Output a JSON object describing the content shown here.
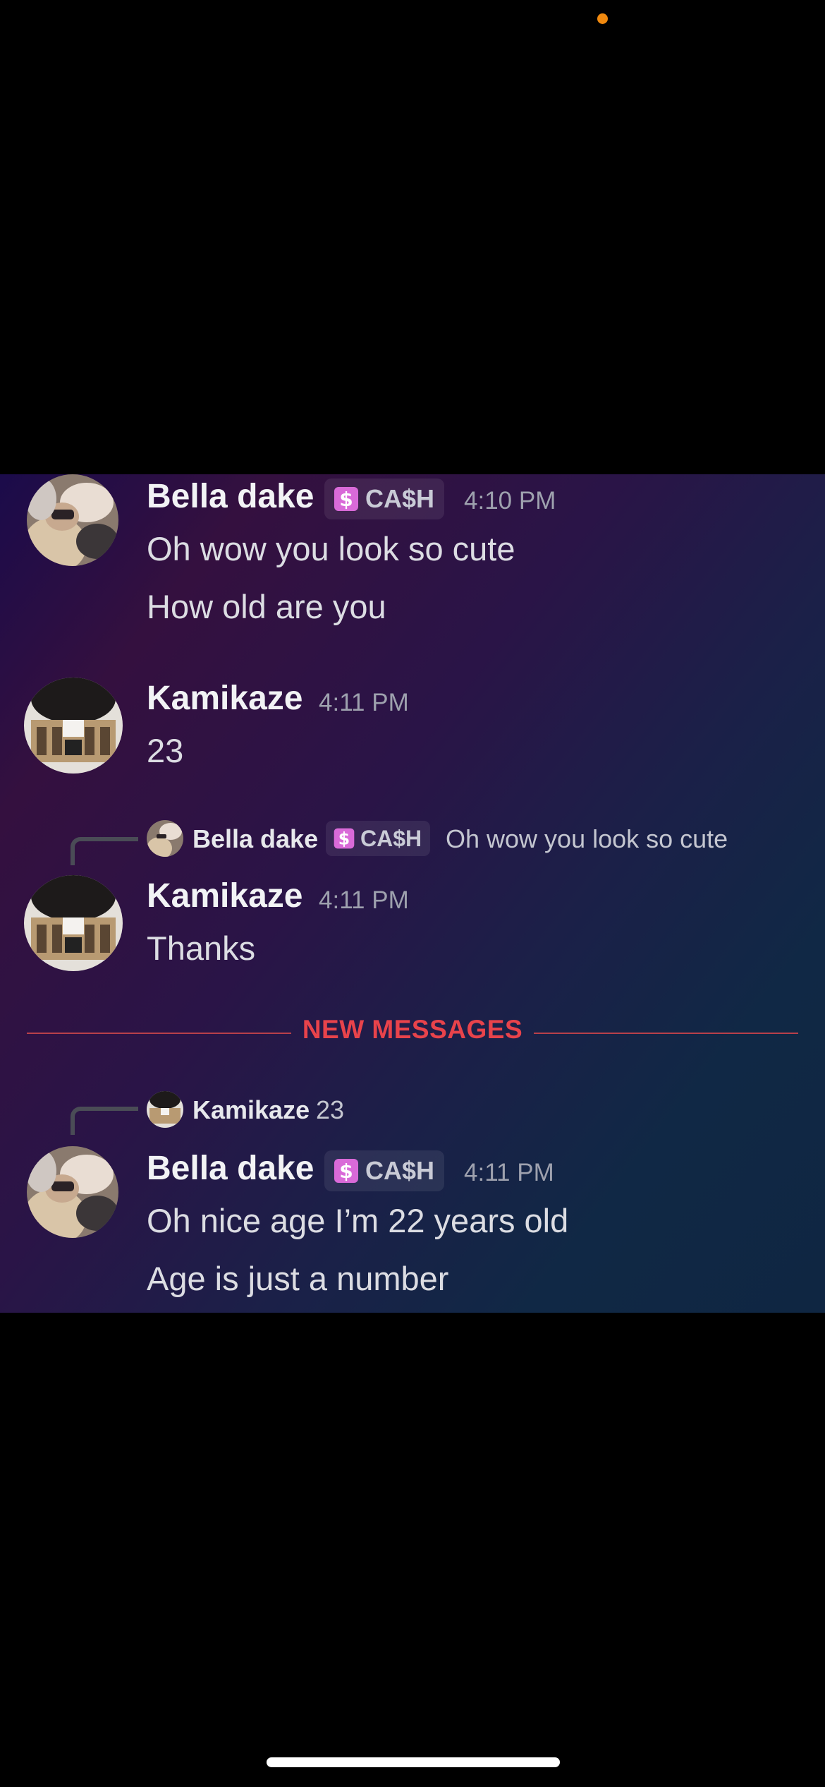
{
  "role_tag": {
    "label": "CA$H",
    "icon": "cash-role-icon",
    "color": "#d96ad8"
  },
  "messages": [
    {
      "author": "Bella dake",
      "tag": "CA$H",
      "time": "4:10 PM",
      "lines": [
        "Oh wow you look so cute",
        "How old are you"
      ]
    },
    {
      "author": "Kamikaze",
      "time": "4:11 PM",
      "lines": [
        "23"
      ]
    },
    {
      "reply_to": {
        "author": "Bella dake",
        "tag": "CA$H",
        "text": "Oh wow you look so cute"
      },
      "author": "Kamikaze",
      "time": "4:11 PM",
      "lines": [
        "Thanks"
      ]
    },
    {
      "reply_to": {
        "author": "Kamikaze",
        "text": "23"
      },
      "author": "Bella dake",
      "tag": "CA$H",
      "time": "4:11 PM",
      "lines": [
        "Oh nice age I’m 22 years old",
        "Age is just a number"
      ]
    }
  ],
  "divider": {
    "label": "NEW MESSAGES",
    "color": "#e8434b"
  },
  "colors": {
    "status_dot": "#f0890f",
    "username": "#f2f3f5",
    "timestamp": "#9ea1ae"
  }
}
